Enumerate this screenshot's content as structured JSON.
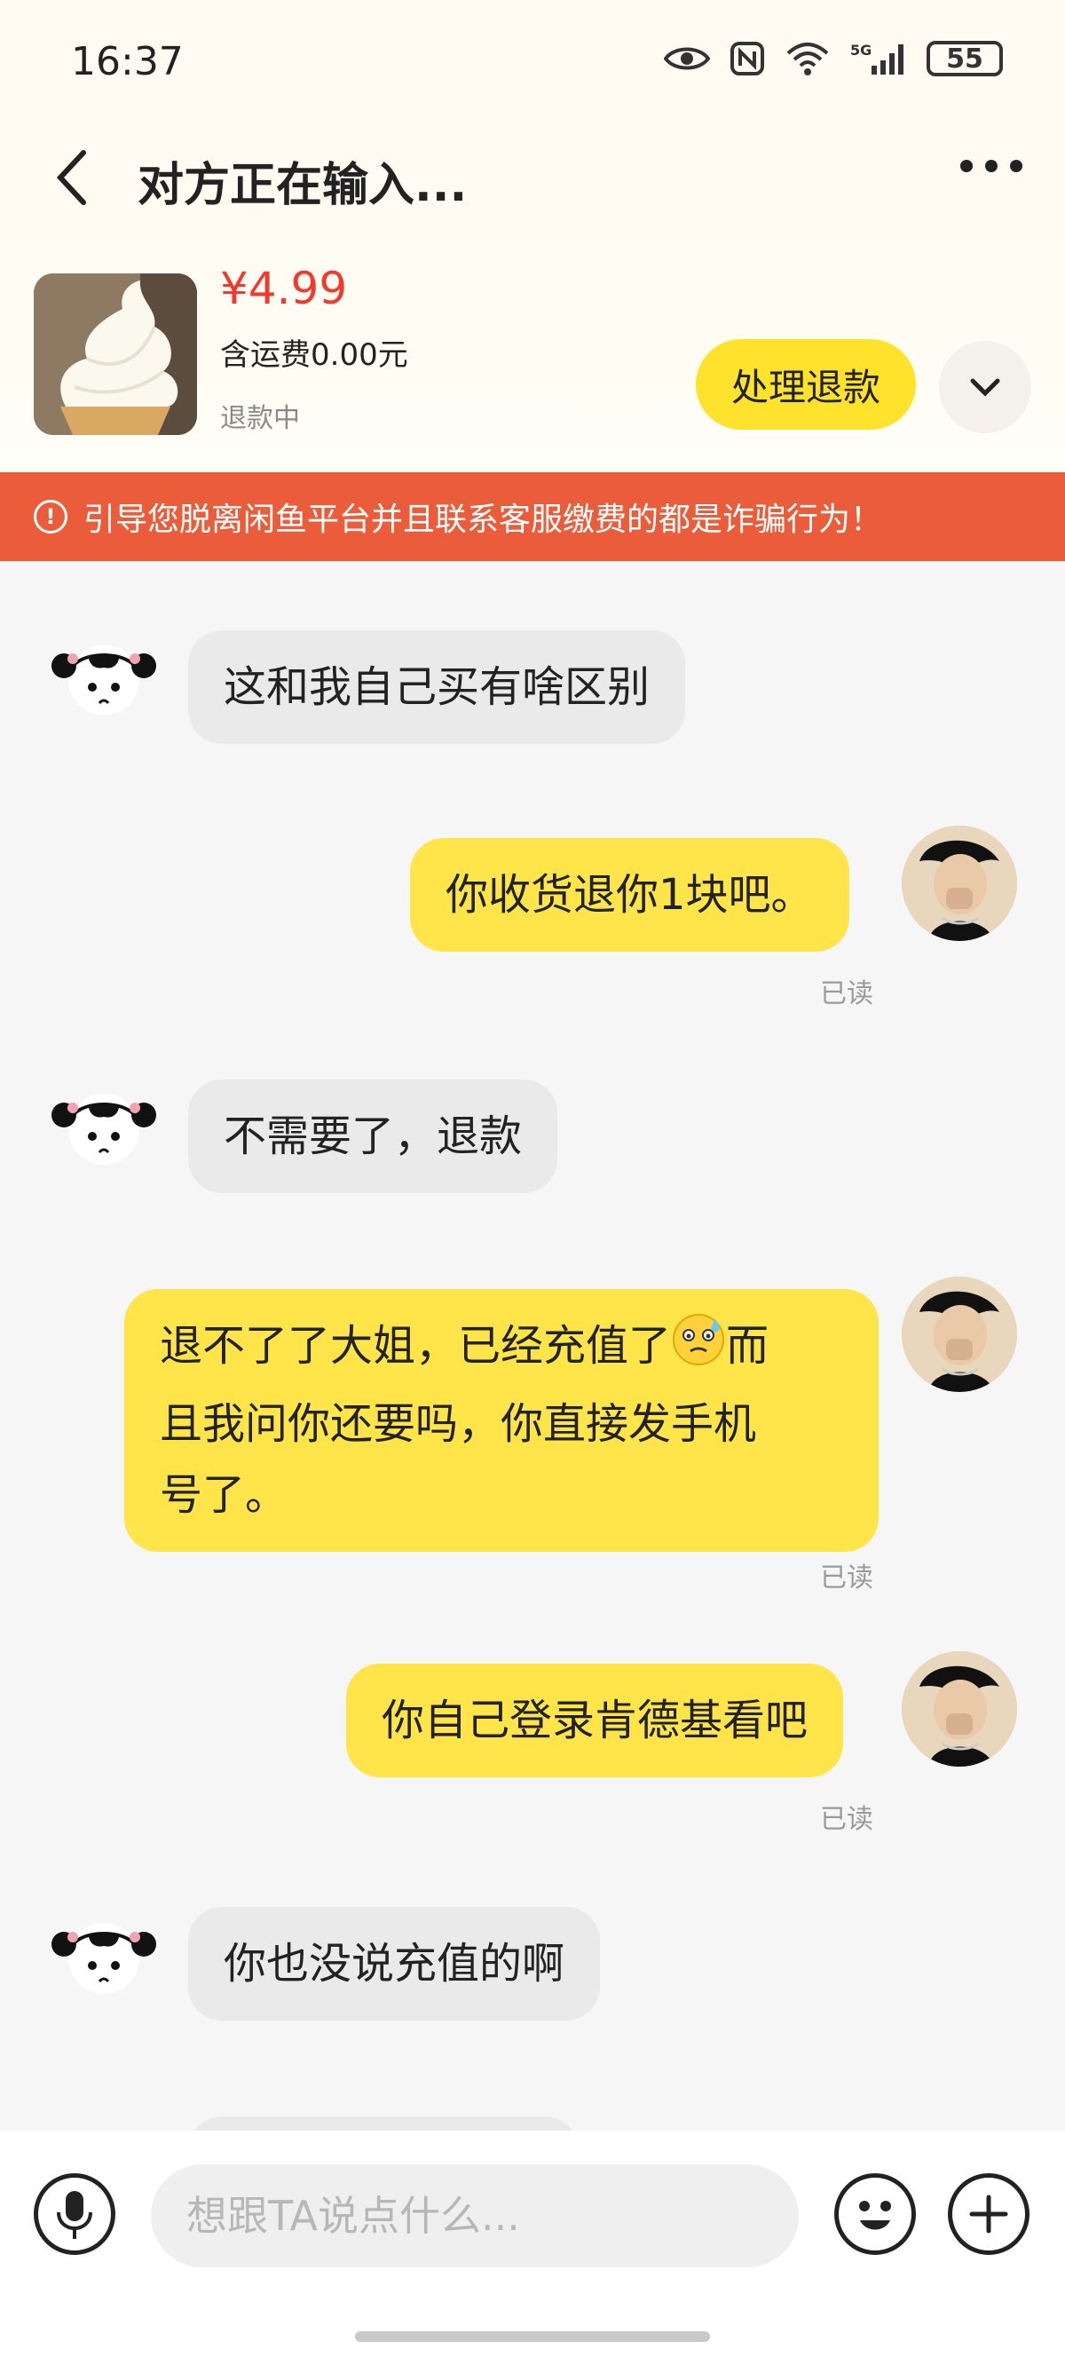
{
  "status_bar": {
    "time": "16:37",
    "battery": "55"
  },
  "header": {
    "title": "对方正在输入..."
  },
  "product": {
    "price": "¥4.99",
    "shipping": "含运费0.00元",
    "status": "退款中",
    "action_label": "处理退款"
  },
  "warning": {
    "text": "引导您脱离闲鱼平台并且联系客服缴费的都是诈骗行为！"
  },
  "messages": [
    {
      "side": "left",
      "text": "这和我自己买有啥区别"
    },
    {
      "side": "right",
      "text": "你收货退你1块吧。",
      "status": "已读"
    },
    {
      "side": "left",
      "text": "不需要了，退款"
    },
    {
      "side": "right",
      "text_line1": "退不了了大姐，已经充值了",
      "text_line1b": "而",
      "text_line2": "且我问你还要吗，你直接发手机",
      "text_line3": "号了。",
      "status": "已读"
    },
    {
      "side": "right",
      "text": "你自己登录肯德基看吧",
      "status": "已读"
    },
    {
      "side": "left",
      "text": "你也没说充值的啊"
    }
  ],
  "composer": {
    "placeholder": "想跟TA说点什么..."
  },
  "colors": {
    "accent": "#ffe22b",
    "price": "#ef3b2d",
    "warning": "#eb5d3a"
  }
}
